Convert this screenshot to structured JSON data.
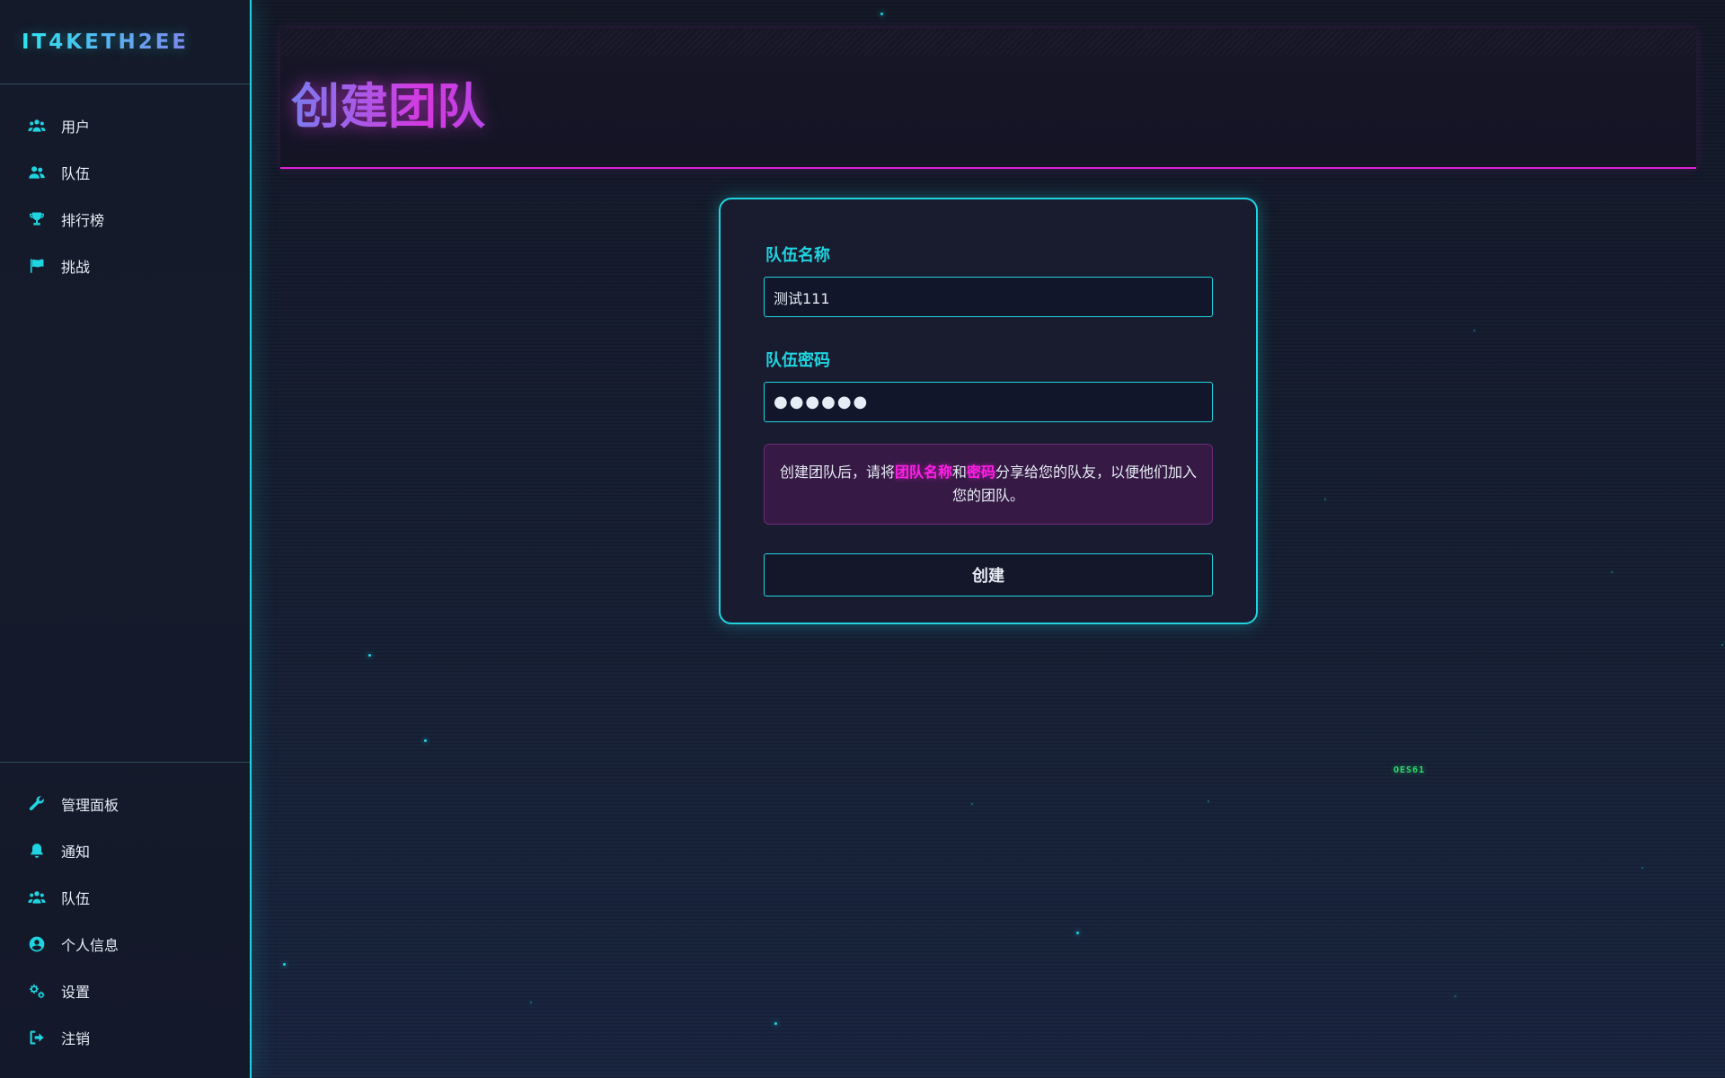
{
  "brand": {
    "name": "IT4KETH2EE"
  },
  "sidebar": {
    "top_items": [
      {
        "label": "用户",
        "icon": "users-icon"
      },
      {
        "label": "队伍",
        "icon": "user-group-icon"
      },
      {
        "label": "排行榜",
        "icon": "trophy-icon"
      },
      {
        "label": "挑战",
        "icon": "flag-icon"
      }
    ],
    "bottom_items": [
      {
        "label": "管理面板",
        "icon": "wrench-icon"
      },
      {
        "label": "通知",
        "icon": "bell-icon"
      },
      {
        "label": "队伍",
        "icon": "users-icon"
      },
      {
        "label": "个人信息",
        "icon": "user-circle-icon"
      },
      {
        "label": "设置",
        "icon": "gears-icon"
      },
      {
        "label": "注销",
        "icon": "sign-out-icon"
      }
    ]
  },
  "header": {
    "title": "创建团队"
  },
  "form": {
    "name_label": "队伍名称",
    "name_value": "测试111",
    "password_label": "队伍密码",
    "password_value": "●●●●●●",
    "notice": {
      "prefix": "创建团队后，请将",
      "highlight_1": "团队名称",
      "middle": "和",
      "highlight_2": "密码",
      "suffix": "分享给您的队友，以便他们加入您的团队。"
    },
    "submit_label": "创建"
  },
  "decor": {
    "floating_code": "OES61"
  },
  "colors": {
    "accent_cyan": "#1fd4e0",
    "accent_magenta": "#e01fd8",
    "highlight_pink": "#ff1fe6",
    "background": "#172035"
  }
}
